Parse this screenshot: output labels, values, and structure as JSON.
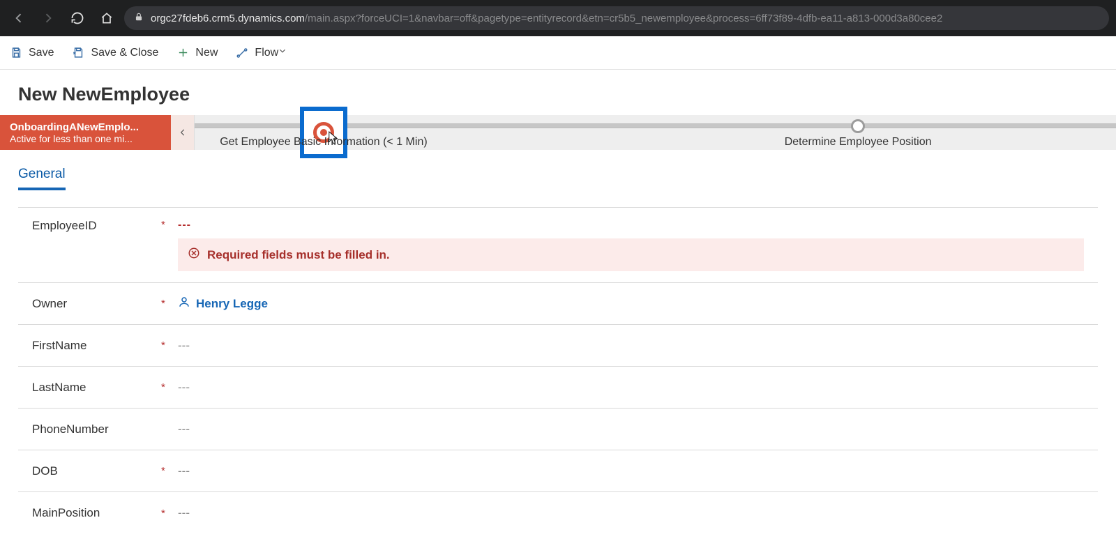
{
  "browser": {
    "url_host": "orgc27fdeb6.crm5.dynamics.com",
    "url_path": "/main.aspx?forceUCI=1&navbar=off&pagetype=entityrecord&etn=cr5b5_newemployee&process=6ff73f89-4dfb-ea11-a813-000d3a80cee2"
  },
  "commands": {
    "save": "Save",
    "save_close": "Save & Close",
    "new": "New",
    "flow": "Flow"
  },
  "header": {
    "title": "New NewEmployee"
  },
  "bpf": {
    "name": "OnboardingANewEmplo...",
    "status": "Active for less than one mi...",
    "stage1": "Get Employee Basic Information  (< 1 Min)",
    "stage2": "Determine Employee Position"
  },
  "tabs": {
    "general": "General"
  },
  "form": {
    "emp_id_label": "EmployeeID",
    "emp_id_value": "---",
    "error_msg": "Required fields must be filled in.",
    "owner_label": "Owner",
    "owner_value": "Henry Legge",
    "first_label": "FirstName",
    "first_value": "---",
    "last_label": "LastName",
    "last_value": "---",
    "phone_label": "PhoneNumber",
    "phone_value": "---",
    "dob_label": "DOB",
    "dob_value": "---",
    "pos_label": "MainPosition",
    "pos_value": "---"
  }
}
